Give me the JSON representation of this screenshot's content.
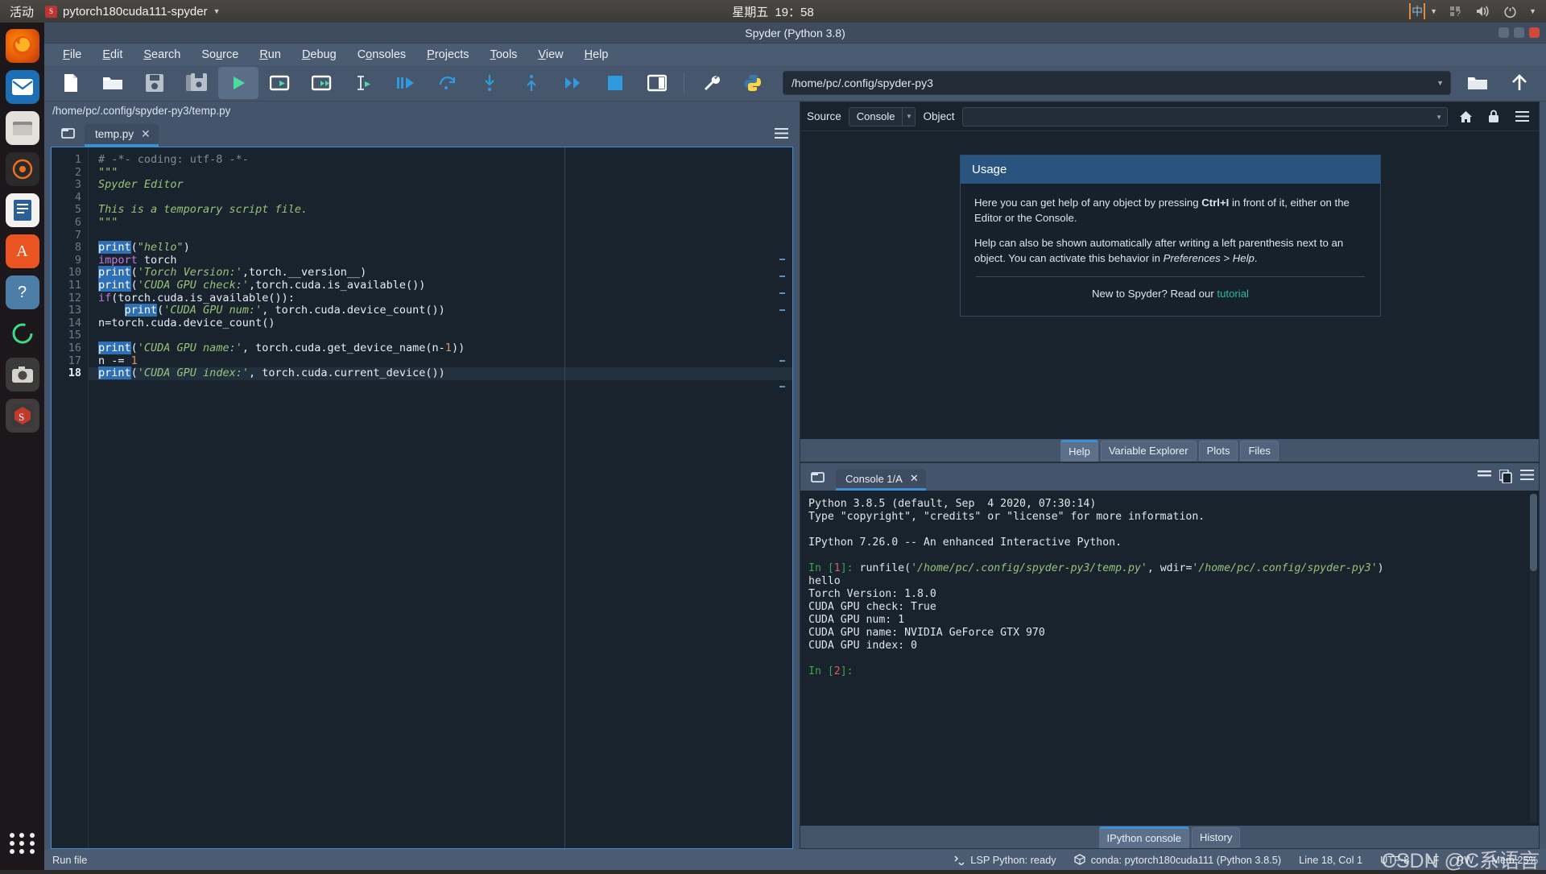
{
  "desktop": {
    "activities": "活动",
    "window_menu_title": "pytorch180cuda111-spyder",
    "clock_weekday": "星期五",
    "clock_time": "19：58",
    "ime_label": "中",
    "dock_items": [
      {
        "name": "firefox",
        "glyph": "🦊"
      },
      {
        "name": "thunderbird",
        "glyph": "✉"
      },
      {
        "name": "files",
        "glyph": "🗄"
      },
      {
        "name": "rhythmbox",
        "glyph": "◎"
      },
      {
        "name": "libreoffice-writer",
        "glyph": "📄"
      },
      {
        "name": "ubuntu-software",
        "glyph": "A"
      },
      {
        "name": "help",
        "glyph": "?"
      },
      {
        "name": "progress-ring",
        "glyph": "◠"
      },
      {
        "name": "screenshot",
        "glyph": "📷"
      },
      {
        "name": "spyder",
        "glyph": "S"
      }
    ]
  },
  "window": {
    "title": "Spyder (Python 3.8)"
  },
  "menubar": [
    {
      "label": "File",
      "mnemonic": "F"
    },
    {
      "label": "Edit",
      "mnemonic": "E"
    },
    {
      "label": "Search",
      "mnemonic": "S"
    },
    {
      "label": "Source",
      "mnemonic": "u"
    },
    {
      "label": "Run",
      "mnemonic": "R"
    },
    {
      "label": "Debug",
      "mnemonic": "D"
    },
    {
      "label": "Consoles",
      "mnemonic": "o"
    },
    {
      "label": "Projects",
      "mnemonic": "P"
    },
    {
      "label": "Tools",
      "mnemonic": "T"
    },
    {
      "label": "View",
      "mnemonic": "V"
    },
    {
      "label": "Help",
      "mnemonic": "H"
    }
  ],
  "toolbar": {
    "buttons": [
      {
        "name": "new-file-button",
        "icon": "new-file-icon",
        "tooltip": "New file"
      },
      {
        "name": "open-file-button",
        "icon": "open-folder-icon",
        "tooltip": "Open file"
      },
      {
        "name": "save-file-button",
        "icon": "save-icon",
        "tooltip": "Save file"
      },
      {
        "name": "save-all-button",
        "icon": "save-all-icon",
        "tooltip": "Save all"
      },
      {
        "name": "run-file-button",
        "icon": "run-play-icon",
        "tooltip": "Run file",
        "active": true
      },
      {
        "name": "run-cell-button",
        "icon": "run-cell-icon",
        "tooltip": "Run current cell"
      },
      {
        "name": "run-cell-advance-button",
        "icon": "run-cell-advance-icon",
        "tooltip": "Run cell and advance"
      },
      {
        "name": "run-selection-button",
        "icon": "run-selection-icon",
        "tooltip": "Run selection"
      },
      {
        "name": "debug-file-button",
        "icon": "debug-icon",
        "tooltip": "Debug file"
      },
      {
        "name": "step-over-button",
        "icon": "step-over-icon",
        "tooltip": "Run current line"
      },
      {
        "name": "step-into-button",
        "icon": "step-into-icon",
        "tooltip": "Step into"
      },
      {
        "name": "step-return-button",
        "icon": "step-return-icon",
        "tooltip": "Step return"
      },
      {
        "name": "continue-button",
        "icon": "continue-icon",
        "tooltip": "Continue"
      },
      {
        "name": "stop-debug-button",
        "icon": "stop-square-icon",
        "tooltip": "Stop debugging"
      },
      {
        "name": "maximize-pane-button",
        "icon": "maximize-pane-icon",
        "tooltip": "Maximize current pane"
      },
      {
        "name": "preferences-button",
        "icon": "wrench-icon",
        "tooltip": "Preferences"
      },
      {
        "name": "pythonpath-button",
        "icon": "python-logo-icon",
        "tooltip": "PYTHONPATH manager"
      }
    ],
    "path_value": "/home/pc/.config/spyder-py3",
    "browse_button": "open-directory-icon",
    "parent_button": "parent-directory-icon"
  },
  "editor": {
    "file_path": "/home/pc/.config/spyder-py3/temp.py",
    "tab_label": "temp.py",
    "current_line": 18,
    "total_lines": 18,
    "lines": [
      {
        "n": 1,
        "tokens": [
          {
            "t": "# -*- coding: utf-8 -*-",
            "c": "cmt"
          }
        ]
      },
      {
        "n": 2,
        "tokens": [
          {
            "t": "\"\"\"",
            "c": "str"
          }
        ]
      },
      {
        "n": 3,
        "tokens": [
          {
            "t": "Spyder Editor",
            "c": "str"
          }
        ]
      },
      {
        "n": 4,
        "tokens": []
      },
      {
        "n": 5,
        "tokens": [
          {
            "t": "This is a temporary script file.",
            "c": "str"
          }
        ]
      },
      {
        "n": 6,
        "tokens": [
          {
            "t": "\"\"\"",
            "c": "str"
          }
        ]
      },
      {
        "n": 7,
        "tokens": []
      },
      {
        "n": 8,
        "tokens": [
          {
            "t": "print",
            "c": "bi hl"
          },
          {
            "t": "(",
            "c": "pn"
          },
          {
            "t": "\"hello\"",
            "c": "str"
          },
          {
            "t": ")",
            "c": "pn"
          }
        ]
      },
      {
        "n": 9,
        "tokens": [
          {
            "t": "import",
            "c": "kw"
          },
          {
            "t": " torch",
            "c": "pn"
          }
        ]
      },
      {
        "n": 10,
        "tokens": [
          {
            "t": "print",
            "c": "bi hl"
          },
          {
            "t": "(",
            "c": "pn"
          },
          {
            "t": "'Torch Version:'",
            "c": "str"
          },
          {
            "t": ",torch.__version__)",
            "c": "pn"
          }
        ]
      },
      {
        "n": 11,
        "tokens": [
          {
            "t": "print",
            "c": "bi hl"
          },
          {
            "t": "(",
            "c": "pn"
          },
          {
            "t": "'CUDA GPU check:'",
            "c": "str"
          },
          {
            "t": ",torch.cuda.is_available())",
            "c": "pn"
          }
        ]
      },
      {
        "n": 12,
        "tokens": [
          {
            "t": "if",
            "c": "kw"
          },
          {
            "t": "(torch.cuda.is_available()):",
            "c": "pn"
          }
        ]
      },
      {
        "n": 13,
        "tokens": [
          {
            "t": "    ",
            "c": "pn"
          },
          {
            "t": "print",
            "c": "bi hl"
          },
          {
            "t": "(",
            "c": "pn"
          },
          {
            "t": "'CUDA GPU num:'",
            "c": "str"
          },
          {
            "t": ", torch.cuda.device_count())",
            "c": "pn"
          }
        ]
      },
      {
        "n": 14,
        "tokens": [
          {
            "t": "n=torch.cuda.device_count()",
            "c": "pn"
          }
        ]
      },
      {
        "n": 15,
        "tokens": []
      },
      {
        "n": 16,
        "tokens": [
          {
            "t": "print",
            "c": "bi hl"
          },
          {
            "t": "(",
            "c": "pn"
          },
          {
            "t": "'CUDA GPU name:'",
            "c": "str"
          },
          {
            "t": ", torch.cuda.get_device_name(n-",
            "c": "pn"
          },
          {
            "t": "1",
            "c": "num"
          },
          {
            "t": "))",
            "c": "pn"
          }
        ]
      },
      {
        "n": 17,
        "tokens": [
          {
            "t": "n -= ",
            "c": "pn"
          },
          {
            "t": "1",
            "c": "num"
          }
        ]
      },
      {
        "n": 18,
        "tokens": [
          {
            "t": "print",
            "c": "bi hl"
          },
          {
            "t": "(",
            "c": "pn"
          },
          {
            "t": "'CUDA GPU index:'",
            "c": "str"
          },
          {
            "t": ", torch.cuda.current_device())",
            "c": "pn"
          }
        ],
        "current": true
      }
    ]
  },
  "help_pane": {
    "source_label": "Source",
    "source_value": "Console",
    "object_label": "Object",
    "object_value": "",
    "usage_title": "Usage",
    "usage_p1_a": "Here you can get help of any object by pressing ",
    "usage_p1_b": "Ctrl+I",
    "usage_p1_c": " in front of it, either on the Editor or the Console.",
    "usage_p2_a": "Help can also be shown automatically after writing a left parenthesis next to an object. You can activate this behavior in ",
    "usage_p2_b": "Preferences > Help",
    "usage_p2_c": ".",
    "footer_text": "New to Spyder? Read our ",
    "footer_link": "tutorial",
    "tabs": [
      {
        "label": "Help",
        "selected": true
      },
      {
        "label": "Variable Explorer",
        "selected": false
      },
      {
        "label": "Plots",
        "selected": false
      },
      {
        "label": "Files",
        "selected": false
      }
    ],
    "toolbar_icons": [
      "home-icon",
      "lock-icon",
      "options-menu-icon"
    ]
  },
  "console_pane": {
    "tab_label": "Console 1/A",
    "lines": [
      {
        "segments": [
          {
            "t": "Python 3.8.5 (default, Sep  4 2020, 07:30:14)",
            "c": ""
          }
        ]
      },
      {
        "segments": [
          {
            "t": "Type \"copyright\", \"credits\" or \"license\" for more information.",
            "c": ""
          }
        ]
      },
      {
        "segments": []
      },
      {
        "segments": [
          {
            "t": "IPython 7.26.0 -- An enhanced Interactive Python.",
            "c": ""
          }
        ]
      },
      {
        "segments": []
      },
      {
        "segments": [
          {
            "t": "In [",
            "c": "in-prompt"
          },
          {
            "t": "1",
            "c": "in-num"
          },
          {
            "t": "]: ",
            "c": "in-prompt"
          },
          {
            "t": "runfile(",
            "c": ""
          },
          {
            "t": "'/home/pc/.config/spyder-py3/temp.py'",
            "c": "cstr"
          },
          {
            "t": ", wdir=",
            "c": ""
          },
          {
            "t": "'/home/pc/.config/spyder-py3'",
            "c": "cstr"
          },
          {
            "t": ")",
            "c": ""
          }
        ]
      },
      {
        "segments": [
          {
            "t": "hello",
            "c": ""
          }
        ]
      },
      {
        "segments": [
          {
            "t": "Torch Version: 1.8.0",
            "c": ""
          }
        ]
      },
      {
        "segments": [
          {
            "t": "CUDA GPU check: True",
            "c": ""
          }
        ]
      },
      {
        "segments": [
          {
            "t": "CUDA GPU num: 1",
            "c": ""
          }
        ]
      },
      {
        "segments": [
          {
            "t": "CUDA GPU name: NVIDIA GeForce GTX 970",
            "c": ""
          }
        ]
      },
      {
        "segments": [
          {
            "t": "CUDA GPU index: 0",
            "c": ""
          }
        ]
      },
      {
        "segments": []
      },
      {
        "segments": [
          {
            "t": "In [",
            "c": "in-prompt"
          },
          {
            "t": "2",
            "c": "in-num"
          },
          {
            "t": "]:",
            "c": "in-prompt"
          }
        ]
      }
    ],
    "tabs": [
      {
        "label": "IPython console",
        "selected": true
      },
      {
        "label": "History",
        "selected": false
      }
    ]
  },
  "statusbar": {
    "left_label": "Run file",
    "lsp_status": "LSP Python: ready",
    "conda_status": "conda: pytorch180cuda111 (Python 3.8.5)",
    "cursor_position": "Line 18, Col 1",
    "encoding": "UTF-8",
    "eol": "LF",
    "permissions": "RW",
    "memory": "Mem 25%"
  },
  "watermark": "CSDN @C系语言"
}
